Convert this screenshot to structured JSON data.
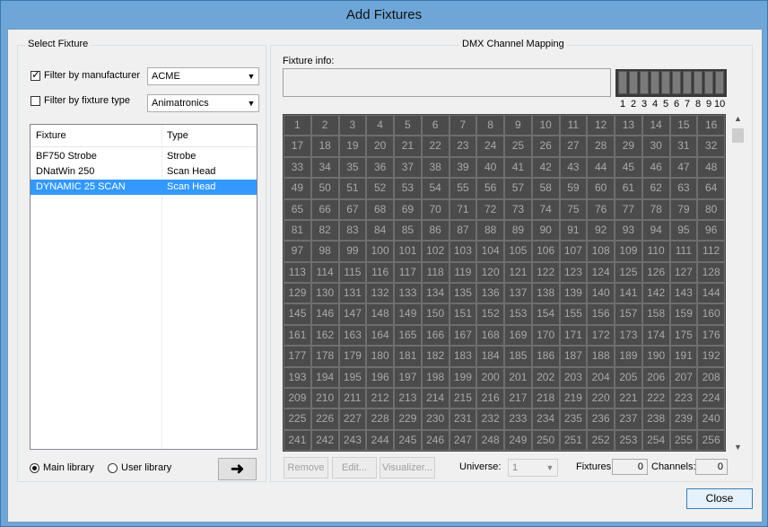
{
  "window": {
    "title": "Add Fixtures"
  },
  "left": {
    "group_title": "Select Fixture",
    "filter_manufacturer": {
      "label": "Filter by manufacturer",
      "checked": true,
      "value": "ACME"
    },
    "filter_type": {
      "label": "Filter by fixture type",
      "checked": false,
      "value": "Animatronics"
    },
    "columns": [
      "Fixture",
      "Type"
    ],
    "rows": [
      {
        "fixture": "BF750 Strobe",
        "type": "Strobe",
        "selected": false
      },
      {
        "fixture": "DNatWin 250",
        "type": "Scan Head",
        "selected": false
      },
      {
        "fixture": "DYNAMIC 25 SCAN",
        "type": "Scan Head",
        "selected": true
      }
    ],
    "main_library": "Main library",
    "user_library": "User library",
    "add_arrow": "➜"
  },
  "right": {
    "group_title": "DMX Channel Mapping",
    "fixture_info_label": "Fixture info:",
    "mini_labels": [
      "1",
      "2",
      "3",
      "4",
      "5",
      "6",
      "7",
      "8",
      "9",
      "10"
    ],
    "channel_count": 256,
    "remove": "Remove",
    "edit": "Edit...",
    "visualizer": "Visualizer...",
    "universe_label": "Universe:",
    "universe_value": "1",
    "fixtures_label": "Fixtures:",
    "fixtures_value": "0",
    "channels_label": "Channels:",
    "channels_value": "0"
  },
  "footer": {
    "close": "Close"
  }
}
